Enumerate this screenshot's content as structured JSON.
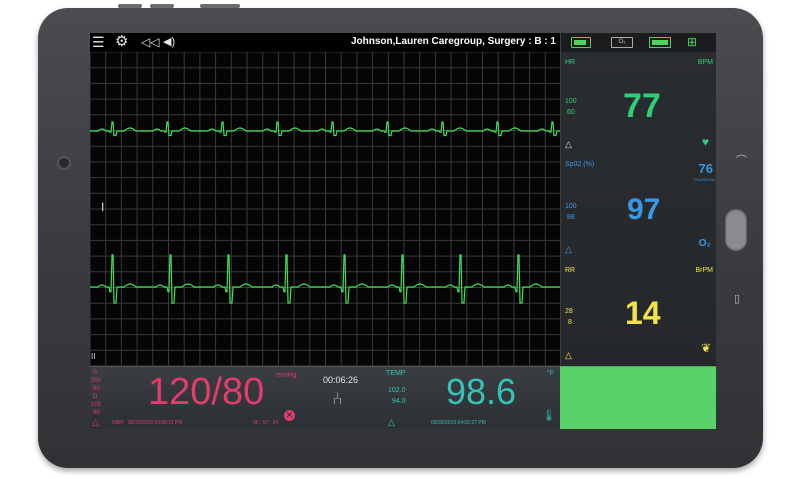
{
  "header": {
    "patient_label": "Johnson,Lauren Caregroup, Surgery : B : 1"
  },
  "icons": {
    "menu": "menu-icon",
    "settings": "gear-icon",
    "rewind": "rewind-icon",
    "volume": "volume-icon",
    "battery": "battery-icon",
    "oxygen": "o2-icon",
    "network": "network-icon",
    "heart": "heart-icon",
    "o2": "o2-icon",
    "lungs": "lungs-icon",
    "alarm": "alarm-triangle-icon",
    "thermometer": "thermometer-icon",
    "bed": "patient-bed-icon",
    "nibp_cancel": "nibp-cancel-icon"
  },
  "hr": {
    "label": "HR",
    "unit": "BPM",
    "upper": "100",
    "lower": "60",
    "value": "77",
    "pulse_value": "76",
    "pulse_unit": "PULSE/min",
    "color": "#2fce78"
  },
  "spo2": {
    "label": "Sp02 (%)",
    "upper": "100",
    "lower": "88",
    "value": "97",
    "color": "#3b97e6"
  },
  "rr": {
    "label": "RR",
    "unit": "BrPM",
    "upper": "28",
    "lower": "8",
    "value": "14",
    "color": "#f3e34a"
  },
  "nibp": {
    "scale_labels": [
      "S",
      "200",
      "90",
      "D",
      "105",
      "40"
    ],
    "value": "120/80",
    "unit": "mmHg",
    "footer_label": "NIBP",
    "timestamp": "05/30/2019 03:58:11 PM",
    "interval": "05 : 57 : 24",
    "color": "#e23b6c"
  },
  "timer": {
    "value": "00:06:26"
  },
  "temp": {
    "label": "TEMP",
    "unit": "°F",
    "upper": "102.0",
    "lower": "94.0",
    "value": "98.6",
    "timestamp": "05/30/2019 04:02:27 PM",
    "color": "#35c3b6"
  },
  "ecg_left_markers": [
    "I",
    "II"
  ],
  "colors": {
    "ecg": "#3fe05a",
    "grid": "#3a3a3a",
    "green_box": "#57d36a"
  }
}
